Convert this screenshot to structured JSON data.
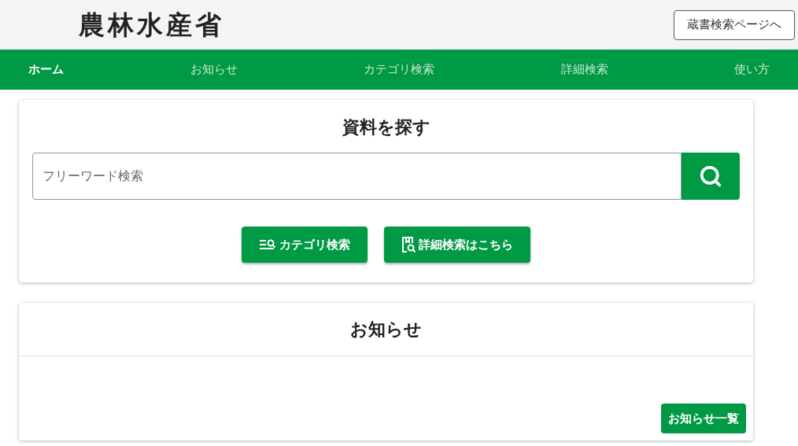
{
  "header": {
    "logo": "農林水産省",
    "catalog_button": "蔵書検索ページへ"
  },
  "nav": [
    {
      "label": "ホーム",
      "selected": true
    },
    {
      "label": "お知らせ",
      "selected": false
    },
    {
      "label": "カテゴリ検索",
      "selected": false
    },
    {
      "label": "詳細検索",
      "selected": false
    },
    {
      "label": "使い方",
      "selected": false
    }
  ],
  "search_card": {
    "title": "資料を探す",
    "search": {
      "placeholder": "フリーワード検索"
    },
    "buttons": [
      {
        "kind": "category",
        "label": "カテゴリ検索"
      },
      {
        "kind": "detail",
        "label": "詳細検索はこちら"
      }
    ]
  },
  "news_card": {
    "title": "お知らせ",
    "list_button": "お知らせ一覧"
  }
}
